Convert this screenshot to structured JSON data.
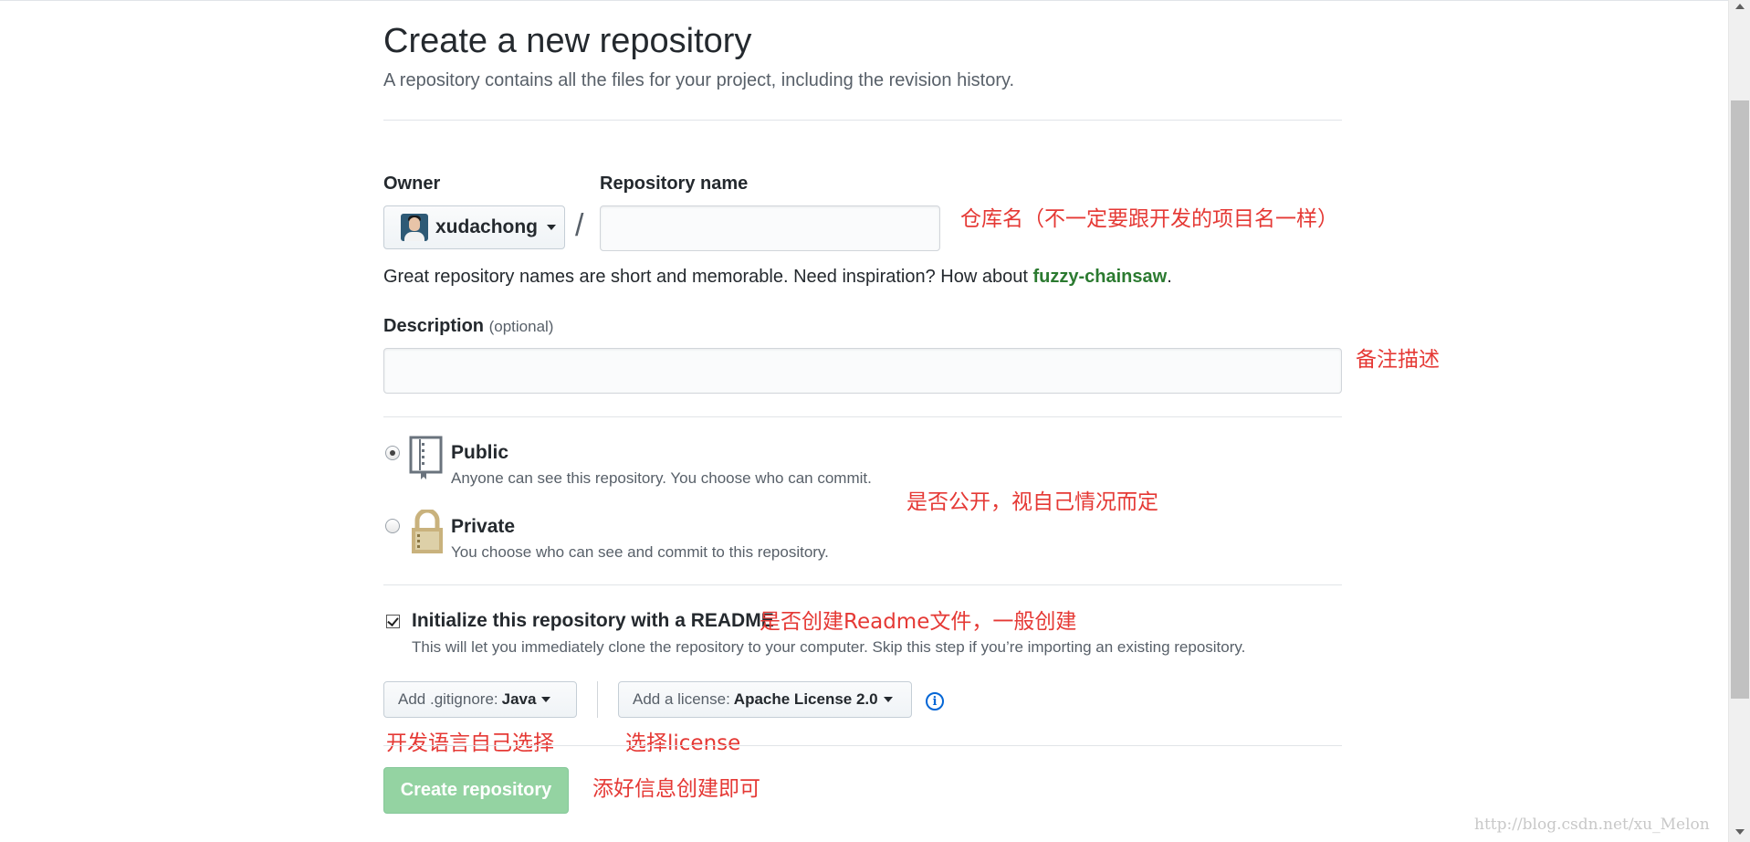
{
  "page": {
    "title": "Create a new repository",
    "subtitle": "A repository contains all the files for your project, including the revision history."
  },
  "owner": {
    "label": "Owner",
    "name": "xudachong"
  },
  "repo_name": {
    "label": "Repository name",
    "value": "",
    "placeholder": ""
  },
  "name_hint": {
    "prefix": "Great repository names are short and memorable. Need inspiration? How about ",
    "suggestion": "fuzzy-chainsaw",
    "suffix": "."
  },
  "description": {
    "label": "Description",
    "optional": "(optional)",
    "value": ""
  },
  "visibility": {
    "selected": "public",
    "public": {
      "title": "Public",
      "desc": "Anyone can see this repository. You choose who can commit."
    },
    "private": {
      "title": "Private",
      "desc": "You choose who can see and commit to this repository."
    }
  },
  "readme": {
    "checked": true,
    "title": "Initialize this repository with a README",
    "desc": "This will let you immediately clone the repository to your computer. Skip this step if you’re importing an existing repository."
  },
  "gitignore": {
    "prefix": "Add .gitignore:",
    "value": "Java"
  },
  "license": {
    "prefix": "Add a license:",
    "value": "Apache License 2.0"
  },
  "create_button": "Create repository",
  "annotations": {
    "repo_name": "仓库名（不一定要跟开发的项目名一样）",
    "description": "备注描述",
    "visibility": "是否公开，视自己情况而定",
    "readme": "是否创建Readme文件，一般创建",
    "gitignore": "开发语言自己选择",
    "license": "选择license",
    "create": "添好信息创建即可"
  },
  "watermark": "http://blog.csdn.net/xu_Melon",
  "colors": {
    "annotation": "#e53935",
    "create_button": "#94d3a2",
    "suggestion": "#2b7a30",
    "info": "#0366d6"
  }
}
